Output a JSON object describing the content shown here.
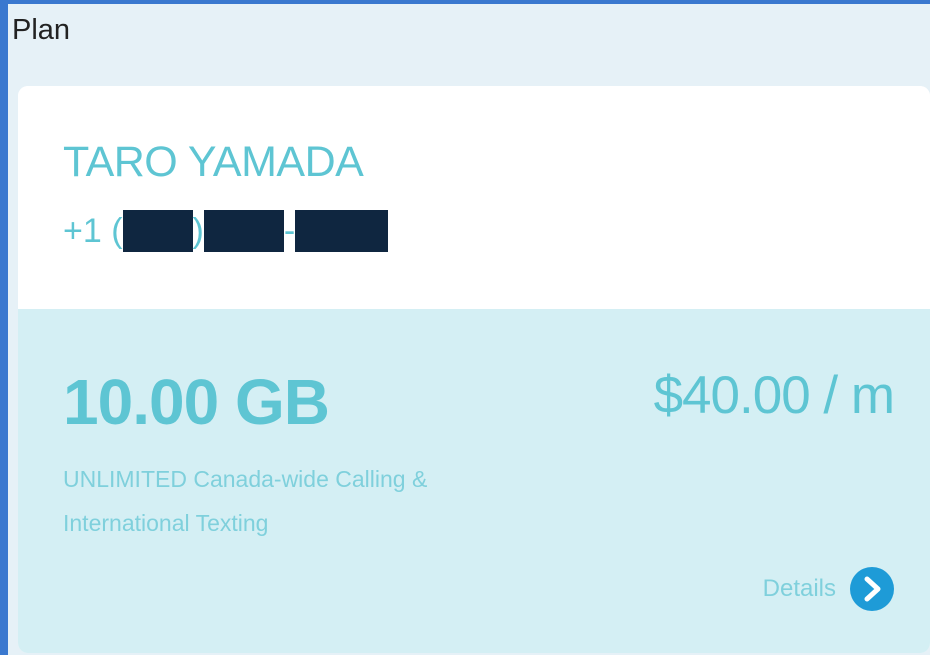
{
  "section": {
    "title": "Plan"
  },
  "account": {
    "owner_name": "TARO YAMADA",
    "phone_prefix": "+1 (",
    "phone_close_paren": ")",
    "phone_dash": "-"
  },
  "plan": {
    "data_amount": "10.00 GB",
    "price": "$40.00 / m",
    "features": "UNLIMITED Canada-wide Calling & International Texting",
    "details_label": "Details",
    "details_icon": "chevron-right-circle-icon"
  },
  "colors": {
    "accent": "#5ec5d3",
    "accent_light": "#7fd0dc",
    "card_bottom": "#d4eff4",
    "page_background": "#e6f1f7",
    "redaction": "#0f2640",
    "details_icon": "#1e9bd7"
  }
}
